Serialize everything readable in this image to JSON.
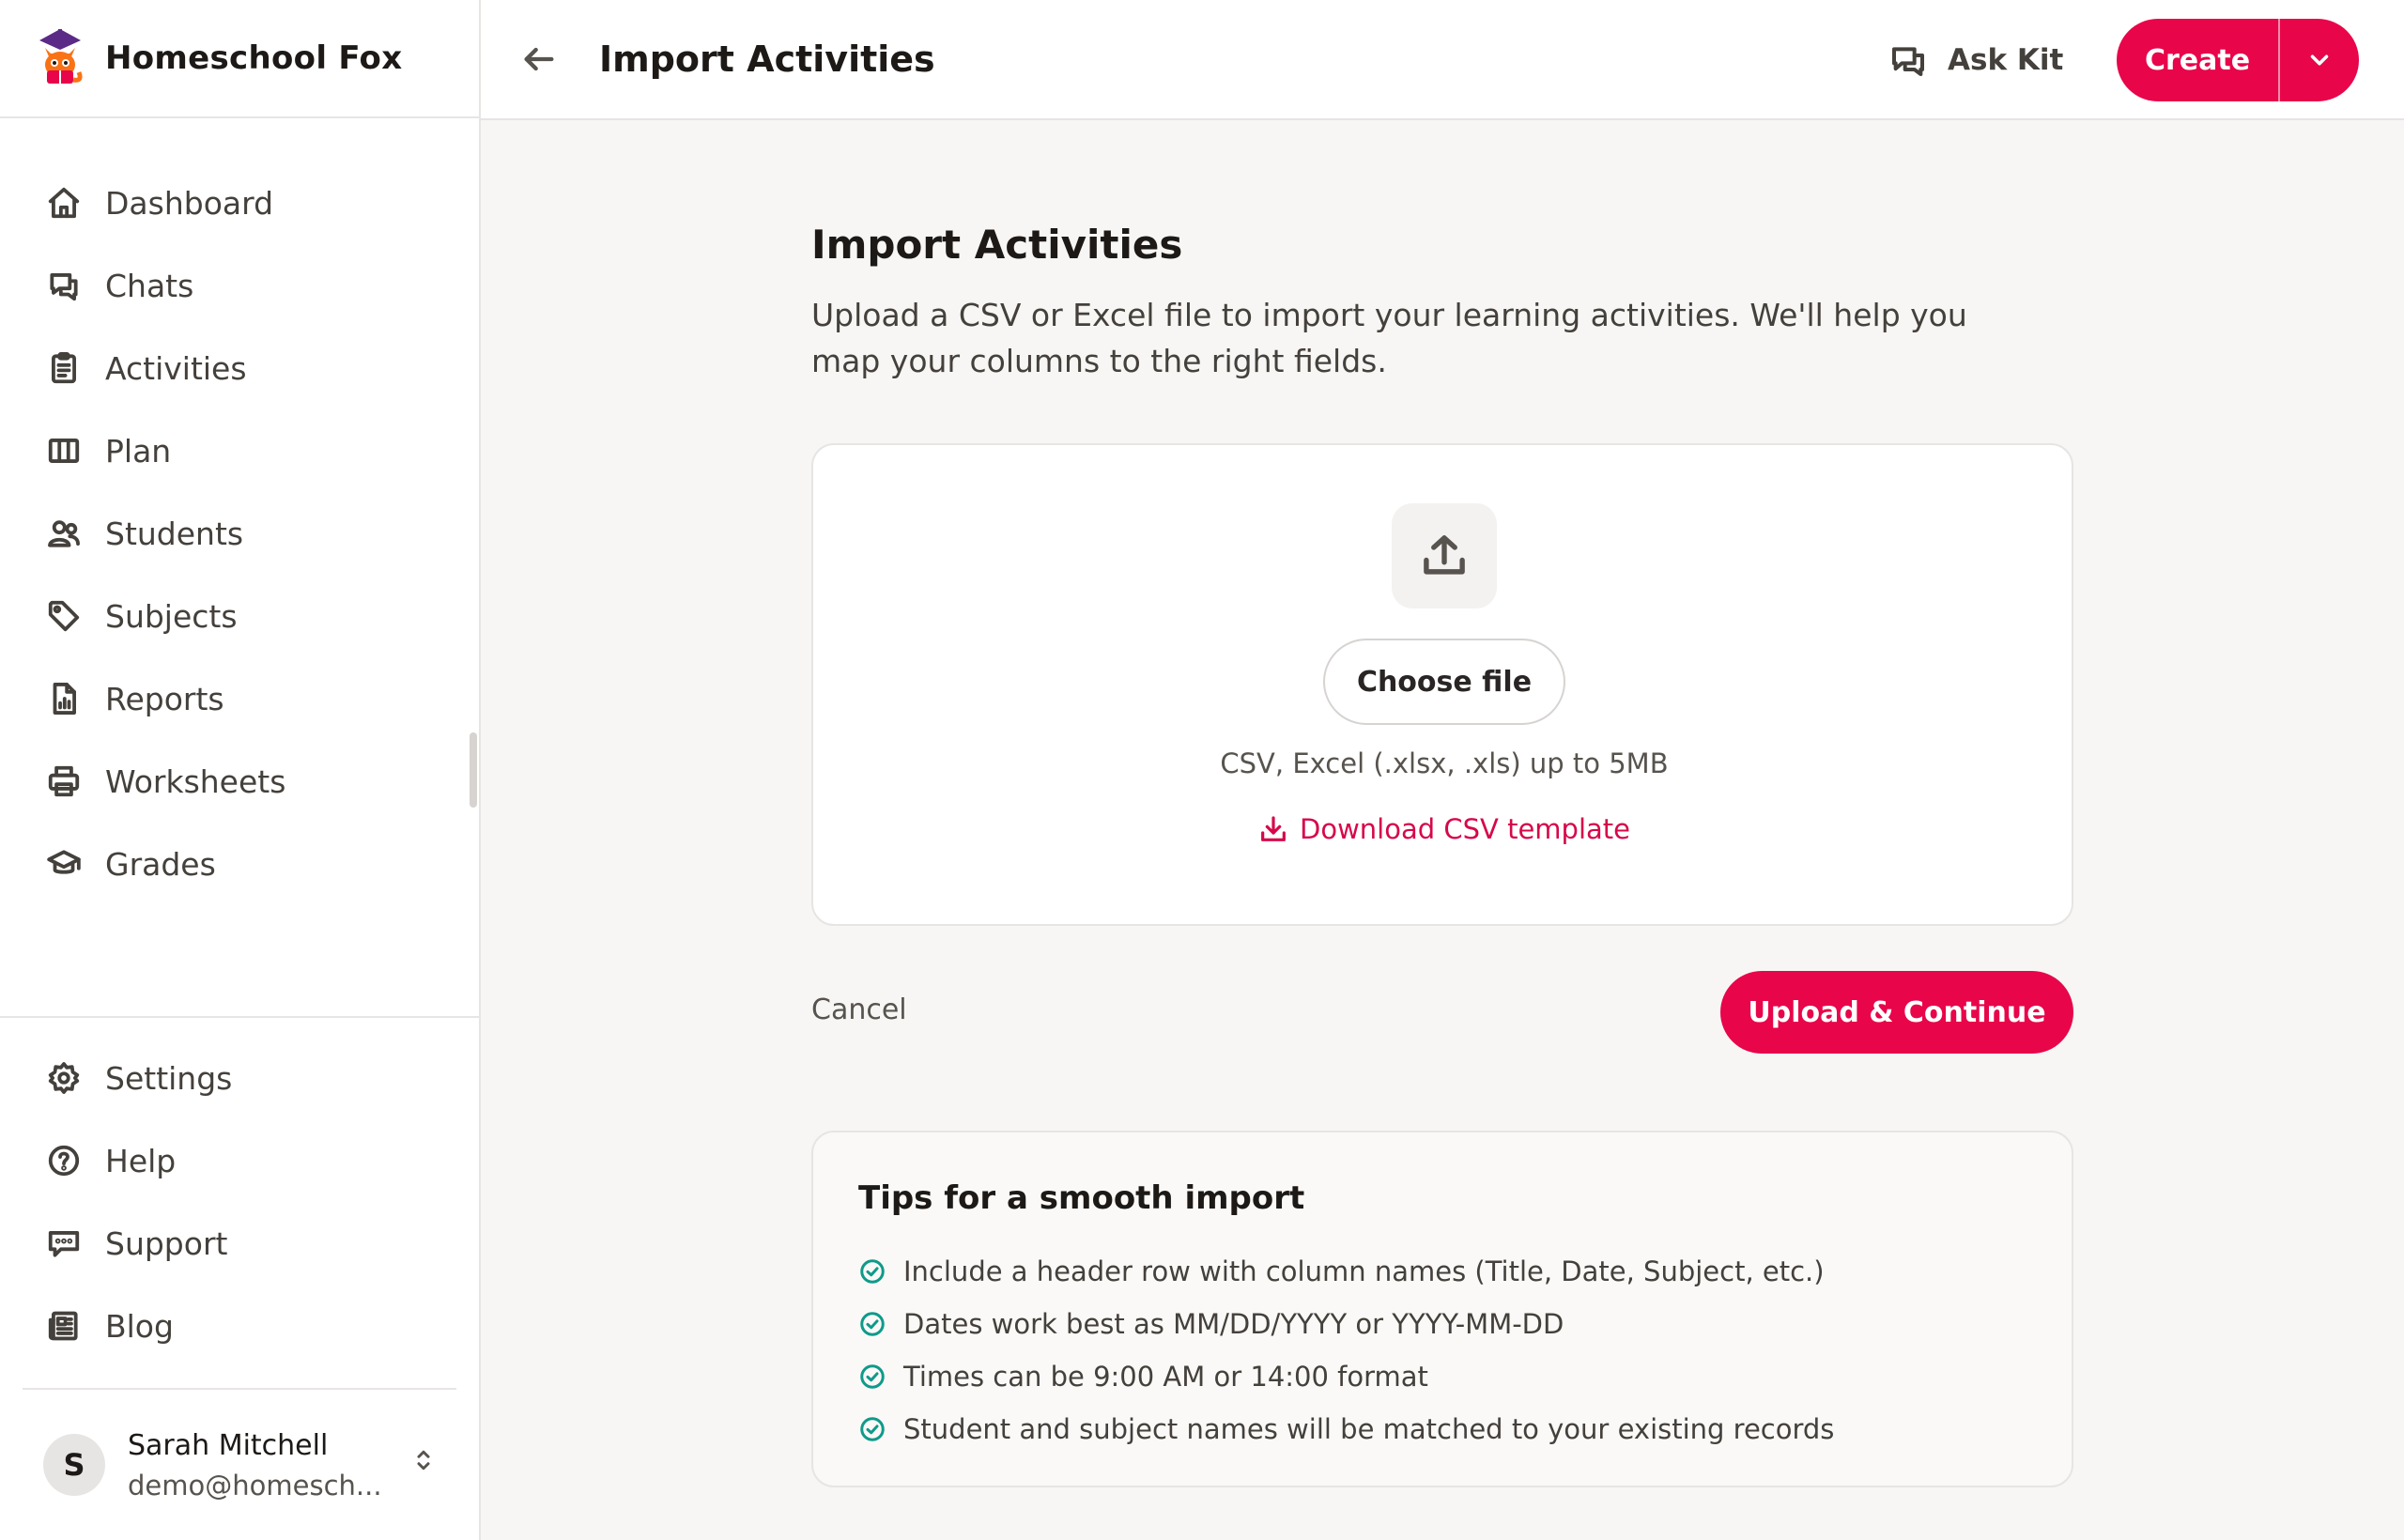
{
  "app": {
    "name": "Homeschool Fox"
  },
  "sidebar": {
    "items": [
      {
        "label": "Dashboard",
        "icon": "home-icon"
      },
      {
        "label": "Chats",
        "icon": "chat-icon"
      },
      {
        "label": "Activities",
        "icon": "clipboard-icon"
      },
      {
        "label": "Plan",
        "icon": "columns-icon"
      },
      {
        "label": "Students",
        "icon": "users-icon"
      },
      {
        "label": "Subjects",
        "icon": "tag-icon"
      },
      {
        "label": "Reports",
        "icon": "report-icon"
      },
      {
        "label": "Worksheets",
        "icon": "printer-icon"
      },
      {
        "label": "Grades",
        "icon": "graduation-cap-icon"
      }
    ],
    "bottom_items": [
      {
        "label": "Settings",
        "icon": "gear-icon"
      },
      {
        "label": "Help",
        "icon": "help-circle-icon"
      },
      {
        "label": "Support",
        "icon": "message-icon"
      },
      {
        "label": "Blog",
        "icon": "newspaper-icon"
      }
    ],
    "user": {
      "initial": "S",
      "name": "Sarah Mitchell",
      "email": "demo@homesch..."
    }
  },
  "header": {
    "title": "Import Activities",
    "ask_kit_label": "Ask Kit",
    "create_label": "Create"
  },
  "main": {
    "title": "Import Activities",
    "description": "Upload a CSV or Excel file to import your learning activities. We'll help you map your columns to the right fields.",
    "upload": {
      "choose_label": "Choose file",
      "hint": "CSV, Excel (.xlsx, .xls) up to 5MB",
      "template_link": "Download CSV template"
    },
    "cancel_label": "Cancel",
    "submit_label": "Upload & Continue",
    "tips": {
      "title": "Tips for a smooth import",
      "items": [
        "Include a header row with column names (Title, Date, Subject, etc.)",
        "Dates work best as MM/DD/YYYY or YYYY-MM-DD",
        "Times can be 9:00 AM or 14:00 format",
        "Student and subject names will be matched to your existing records"
      ]
    }
  },
  "colors": {
    "accent": "#e8054a",
    "link": "#d6084a",
    "check": "#0f9a8a",
    "background": "#f7f6f4"
  }
}
